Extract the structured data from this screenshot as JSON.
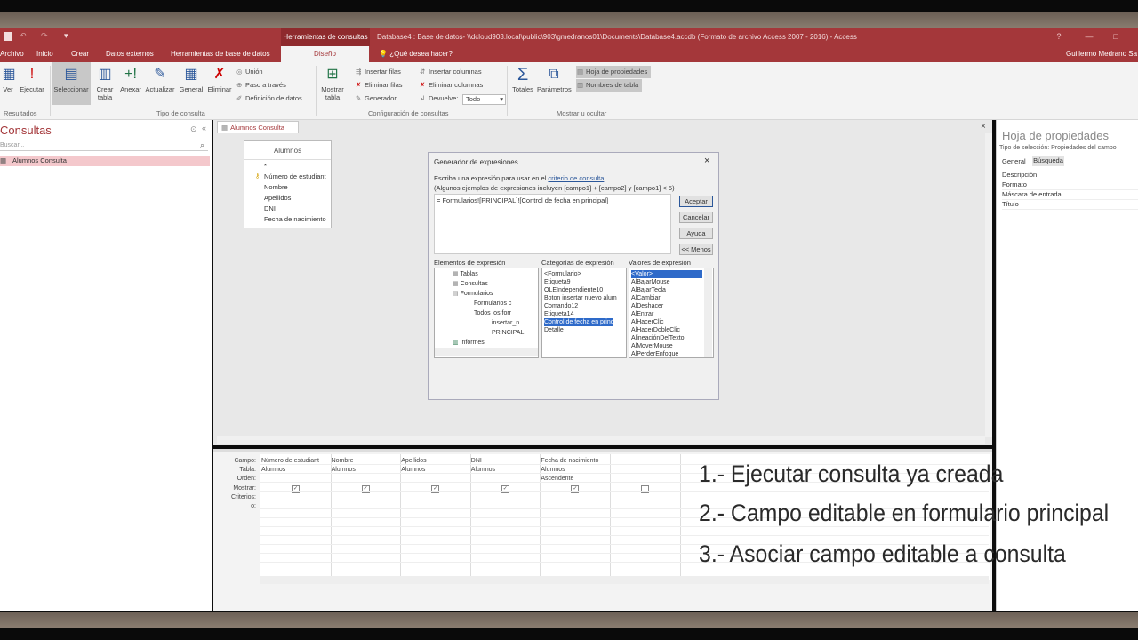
{
  "titlebar": {
    "contextual_tab": "Herramientas de consultas",
    "document": "Database4 : Base de datos- \\\\dcloud903.local\\public\\903\\gmedranos01\\Documents\\Database4.accdb (Formato de archivo Access 2007 - 2016) - Access",
    "help": "?",
    "minimize": "—",
    "maximize": "□"
  },
  "ribbon_tabs": {
    "archivo": "Archivo",
    "inicio": "Inicio",
    "crear": "Crear",
    "datos_externos": "Datos externos",
    "herramientas_bd": "Herramientas de base de datos",
    "diseno": "Diseño",
    "tell_me": "¿Qué desea hacer?",
    "user": "Guillermo Medrano Sa"
  },
  "ribbon": {
    "ver": "Ver",
    "ejecutar": "Ejecutar",
    "seleccionar": "Seleccionar",
    "crear_tabla": "Crear tabla",
    "anexar": "Anexar",
    "actualizar": "Actualizar",
    "general": "General",
    "eliminar": "Eliminar",
    "union": "Unión",
    "paso_a_traves": "Paso a través",
    "definicion_datos": "Definición de datos",
    "mostrar_tabla": "Mostrar tabla",
    "insertar_filas": "Insertar filas",
    "eliminar_filas": "Eliminar filas",
    "generador": "Generador",
    "insertar_columnas": "Insertar columnas",
    "eliminar_columnas": "Eliminar columnas",
    "devuelve_label": "Devuelve:",
    "devuelve_value": "Todo",
    "totales": "Totales",
    "parametros": "Parámetros",
    "hoja_propiedades": "Hoja de propiedades",
    "nombres_tabla": "Nombres de tabla",
    "groups": {
      "resultados": "Resultados",
      "tipo_consulta": "Tipo de consulta",
      "configuracion": "Configuración de consultas",
      "mostrar_ocultar": "Mostrar u ocultar"
    }
  },
  "nav": {
    "title": "Consultas",
    "search_placeholder": "Buscar...",
    "item": "Alumnos Consulta"
  },
  "document_tab": "Alumnos Consulta",
  "table": {
    "name": "Alumnos",
    "fields": [
      "*",
      "Número de estudiant",
      "Nombre",
      "Apellidos",
      "DNI",
      "Fecha de nacimiento"
    ]
  },
  "dialog": {
    "title": "Generador de expresiones",
    "instruction_prefix": "Escriba una expresión para usar en el ",
    "instruction_link": "criterio de consulta",
    "instruction_suffix": ":",
    "examples": "(Algunos ejemplos de expresiones incluyen [campo1] + [campo2] y [campo1] < 5)",
    "expression": "= Formularios![PRINCIPAL]![Control de fecha en principal]",
    "buttons": {
      "aceptar": "Aceptar",
      "cancelar": "Cancelar",
      "ayuda": "Ayuda",
      "menos": "<< Menos"
    },
    "col_elementos": "Elementos de expresión",
    "col_categorias": "Categorías de expresión",
    "col_valores": "Valores de expresión",
    "elementos": [
      "Tablas",
      "Consultas",
      "Formularios",
      "Formularios c",
      "Todos los forr",
      "insertar_n",
      "PRINCIPAL",
      "Informes"
    ],
    "categorias": [
      "<Formulario>",
      "Etiqueta9",
      "OLEIndependiente10",
      "Boton insertar nuevo alum",
      "Comando12",
      "Etiqueta14",
      "Control de fecha en princ",
      "Detalle"
    ],
    "valores": [
      "<Valor>",
      "AlBajarMouse",
      "AlBajarTecla",
      "AlCambiar",
      "AlDeshacer",
      "AlEntrar",
      "AlHacerClic",
      "AlHacerDobleClic",
      "AlineaciónDelTexto",
      "AlMoverMouse",
      "AlPerderEnfoque"
    ]
  },
  "properties": {
    "title": "Hoja de propiedades",
    "selection_label": "Tipo de selección:",
    "selection_value": "Propiedades del campo",
    "tab_general": "General",
    "tab_busqueda": "Búsqueda",
    "rows": [
      "Descripción",
      "Formato",
      "Máscara de entrada",
      "Título"
    ]
  },
  "grid": {
    "row_labels": [
      "Campo:",
      "Tabla:",
      "Orden:",
      "Mostrar:",
      "Criterios:",
      "o:"
    ],
    "columns": [
      {
        "campo": "Número de estudiant",
        "tabla": "Alumnos",
        "orden": ""
      },
      {
        "campo": "Nombre",
        "tabla": "Alumnos",
        "orden": ""
      },
      {
        "campo": "Apellidos",
        "tabla": "Alumnos",
        "orden": ""
      },
      {
        "campo": "DNI",
        "tabla": "Alumnos",
        "orden": ""
      },
      {
        "campo": "Fecha de nacimiento",
        "tabla": "Alumnos",
        "orden": "Ascendente"
      },
      {
        "campo": "",
        "tabla": "",
        "orden": ""
      }
    ],
    "checked": [
      true,
      true,
      true,
      true,
      true,
      false
    ]
  },
  "overlay": [
    "1.- Ejecutar consulta ya creada",
    "2.- Campo editable en formulario principal",
    "3.- Asociar campo editable a consulta"
  ]
}
